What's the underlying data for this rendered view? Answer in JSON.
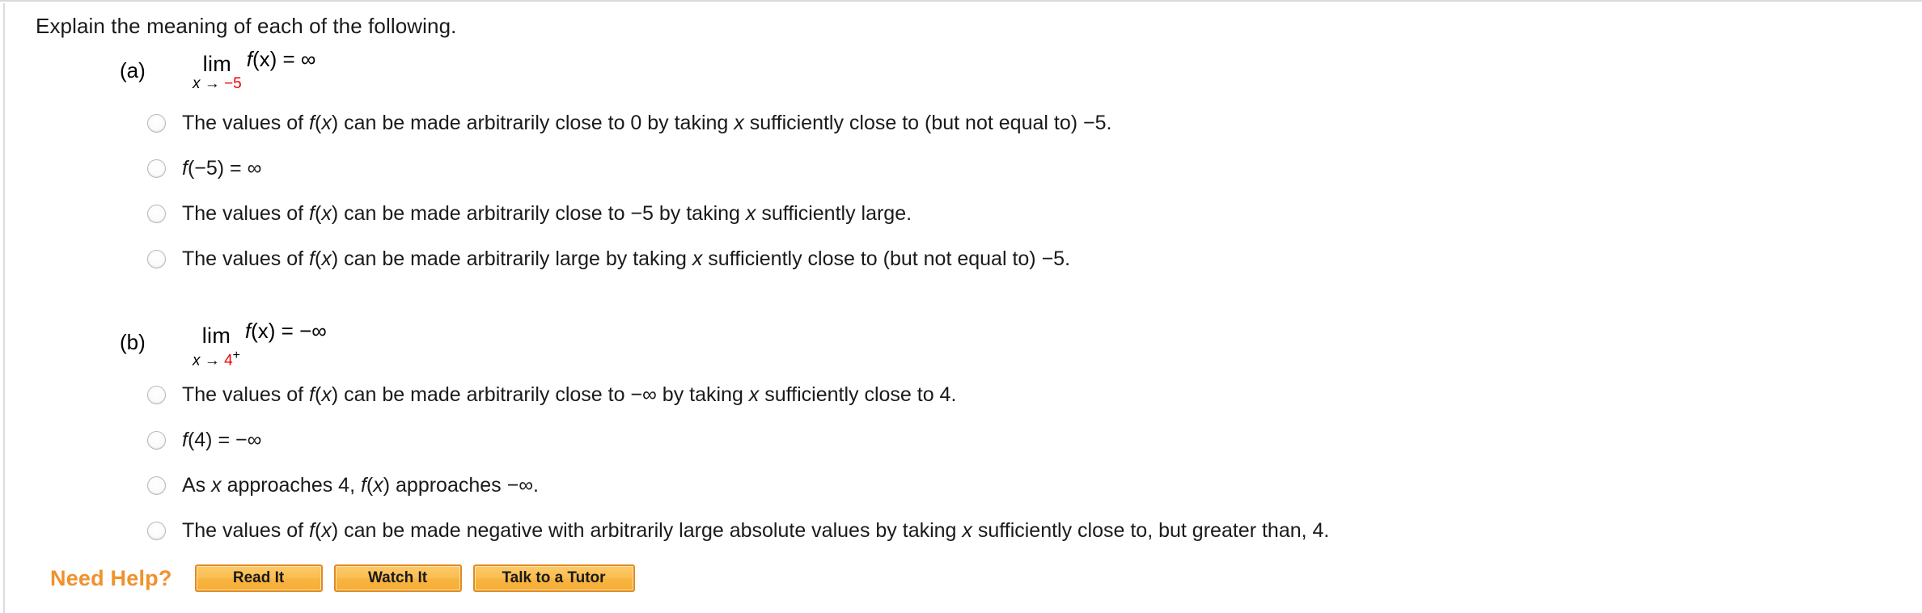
{
  "prompt": "Explain the meaning of each of the following.",
  "colors": {
    "accent_orange": "#f0912d",
    "limit_red": "#ee0000",
    "button_face": "#f8b43f",
    "button_border": "#e08a24"
  },
  "parts": [
    {
      "label": "(a)",
      "limit": {
        "word": "lim",
        "sub_var": "x",
        "sub_arrow": "→",
        "sub_target": "−5",
        "sub_superscript": "",
        "body": "f(x) = ∞",
        "body_fn": "f",
        "body_rest": "(x) = ∞"
      },
      "options": [
        "The values of f(x) can be made arbitrarily close to 0 by taking x sufficiently close to (but not equal to) −5.",
        "f(−5) = ∞",
        "The values of f(x) can be made arbitrarily close to −5 by taking x sufficiently large.",
        "The values of f(x) can be made arbitrarily large by taking x sufficiently close to (but not equal to) −5."
      ]
    },
    {
      "label": "(b)",
      "limit": {
        "word": "lim",
        "sub_var": "x",
        "sub_arrow": "→",
        "sub_target": "4",
        "sub_superscript": "+",
        "body": "f(x) = −∞",
        "body_fn": "f",
        "body_rest": "(x) = −∞"
      },
      "options": [
        "The values of f(x) can be made arbitrarily close to −∞ by taking x sufficiently close to 4.",
        "f(4) = −∞",
        "As x approaches 4, f(x) approaches −∞.",
        "The values of f(x) can be made negative with arbitrarily large absolute values by taking x sufficiently close to, but greater than, 4."
      ]
    }
  ],
  "footer": {
    "need_help_label": "Need Help?",
    "buttons": [
      {
        "label": "Read It"
      },
      {
        "label": "Watch It"
      },
      {
        "label": "Talk to a Tutor"
      }
    ]
  }
}
